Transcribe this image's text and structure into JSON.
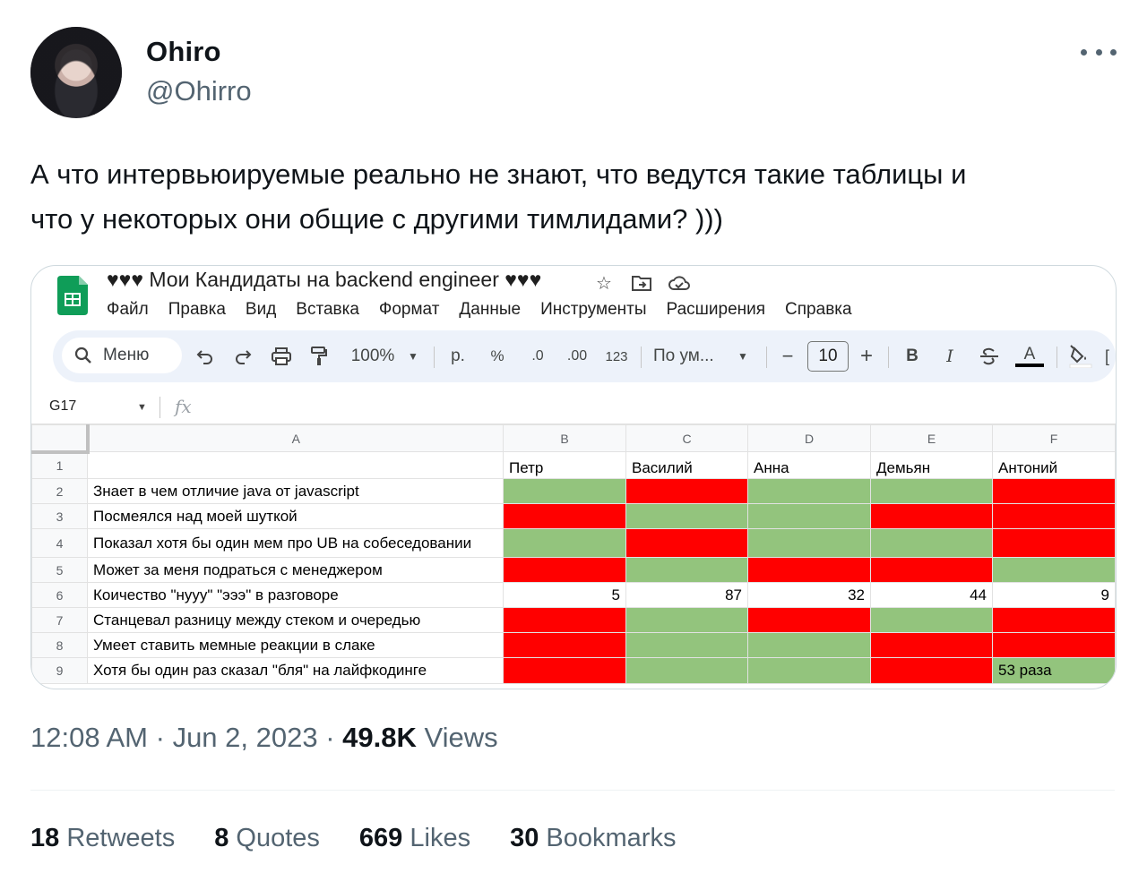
{
  "author": {
    "name": "Ohiro",
    "handle": "@Ohirro"
  },
  "tweet": {
    "text_line1": "А что интервьюируемые реально не знают, что ведутся такие таблицы и",
    "text_line2": "что у некоторых они общие с другими тимлидами? )))"
  },
  "sheet": {
    "title": "♥♥♥ Мои Кандидаты на backend engineer ♥♥♥",
    "menu": [
      "Файл",
      "Правка",
      "Вид",
      "Вставка",
      "Формат",
      "Данные",
      "Инструменты",
      "Расширения",
      "Справка"
    ],
    "toolbar": {
      "search_label": "Меню",
      "zoom": "100%",
      "currency": "р.",
      "percent": "%",
      "dec_decrease": ".0",
      "dec_increase": ".00",
      "format_123": "123",
      "font": "По ум...",
      "font_size": "10",
      "minus": "−",
      "plus": "+",
      "bold": "B",
      "italic": "I",
      "text_color": "A"
    },
    "name_box": "G17",
    "fx": "fx",
    "columns": [
      "A",
      "B",
      "C",
      "D",
      "E",
      "F"
    ],
    "candidates": [
      "Петр",
      "Василий",
      "Анна",
      "Демьян",
      "Антоний"
    ],
    "rows": [
      {
        "n": "1"
      },
      {
        "n": "2",
        "label": "Знает в чем отличие java от javascript",
        "cells": [
          "g",
          "r",
          "g",
          "g",
          "r"
        ]
      },
      {
        "n": "3",
        "label": "Посмеялся над моей шуткой",
        "cells": [
          "r",
          "g",
          "g",
          "r",
          "r"
        ]
      },
      {
        "n": "4",
        "label": "Показал хотя бы один мем про UB на собеседовании",
        "cells": [
          "g",
          "r",
          "g",
          "g",
          "r"
        ]
      },
      {
        "n": "5",
        "label": "Может за меня подраться с менеджером",
        "cells": [
          "r",
          "g",
          "r",
          "r",
          "g"
        ]
      },
      {
        "n": "6",
        "label": "Коичество \"нууу\" \"эээ\" в разговоре",
        "values": [
          "5",
          "87",
          "32",
          "44",
          "9"
        ]
      },
      {
        "n": "7",
        "label": "Станцевал разницу между стеком и очередью",
        "cells": [
          "r",
          "g",
          "r",
          "g",
          "r"
        ]
      },
      {
        "n": "8",
        "label": "Умеет ставить мемные реакции в слаке",
        "cells": [
          "r",
          "g",
          "g",
          "r",
          "r"
        ]
      },
      {
        "n": "9",
        "label": "Хотя бы один раз сказал \"бля\" на лайфкодинге",
        "cells": [
          "r",
          "g",
          "g",
          "r",
          "g"
        ],
        "note": "53 раза"
      }
    ],
    "colors": {
      "yes": "#93c47d",
      "no": "#ff0000"
    }
  },
  "meta": {
    "time": "12:08 AM",
    "date": "Jun 2, 2023",
    "views_count": "49.8K",
    "views_label": "Views",
    "sep": "·"
  },
  "stats": [
    {
      "count": "18",
      "label": "Retweets"
    },
    {
      "count": "8",
      "label": "Quotes"
    },
    {
      "count": "669",
      "label": "Likes"
    },
    {
      "count": "30",
      "label": "Bookmarks"
    }
  ]
}
